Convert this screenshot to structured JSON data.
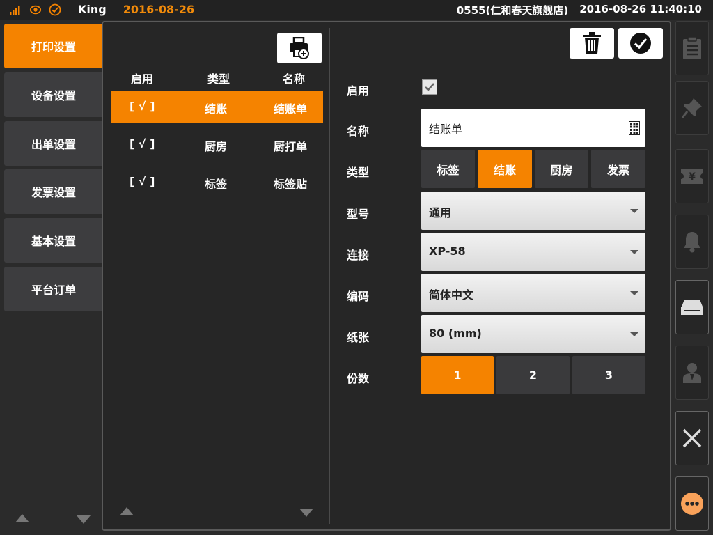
{
  "statusbar": {
    "signal_icon": "signal-bars-icon",
    "sync_icon": "sync-icon",
    "check_icon": "check-circle-icon",
    "user": "King",
    "business_date": "2016-08-26",
    "store": "0555(仁和春天旗舰店)",
    "datetime": "2016-08-26 11:40:10"
  },
  "leftmenu": {
    "items": [
      {
        "label": "打印设置",
        "active": true
      },
      {
        "label": "设备设置",
        "active": false
      },
      {
        "label": "出单设置",
        "active": false
      },
      {
        "label": "发票设置",
        "active": false
      },
      {
        "label": "基本设置",
        "active": false
      },
      {
        "label": "平台订单",
        "active": false
      }
    ]
  },
  "printer_list": {
    "headers": {
      "enabled": "启用",
      "type": "类型",
      "name": "名称"
    },
    "rows": [
      {
        "enabled": "[ √ ]",
        "type": "结账",
        "name": "结账单",
        "selected": true
      },
      {
        "enabled": "[ √ ]",
        "type": "厨房",
        "name": "厨打单",
        "selected": false
      },
      {
        "enabled": "[ √ ]",
        "type": "标签",
        "name": "标签贴",
        "selected": false
      }
    ]
  },
  "form": {
    "labels": {
      "enabled": "启用",
      "name": "名称",
      "type": "类型",
      "model": "型号",
      "connection": "连接",
      "encoding": "编码",
      "paper": "纸张",
      "copies": "份数"
    },
    "enabled_checked": true,
    "name_value": "结账单",
    "type_options": [
      "标签",
      "结账",
      "厨房",
      "发票"
    ],
    "type_selected": "结账",
    "model_value": "通用",
    "connection_value": "XP-58",
    "encoding_value": "简体中文",
    "paper_value": "80 (mm)",
    "copies_options": [
      "1",
      "2",
      "3"
    ],
    "copies_selected": "1"
  },
  "colors": {
    "accent": "#f58300",
    "background": "#2b2b2b",
    "button": "#3d3d3f"
  },
  "sidebar": {
    "icons": [
      "clipboard-icon",
      "pin-icon",
      "yen-ticket-icon",
      "bell-icon",
      "cash-drawer-icon",
      "user-icon",
      "close-icon",
      "more-icon"
    ]
  }
}
